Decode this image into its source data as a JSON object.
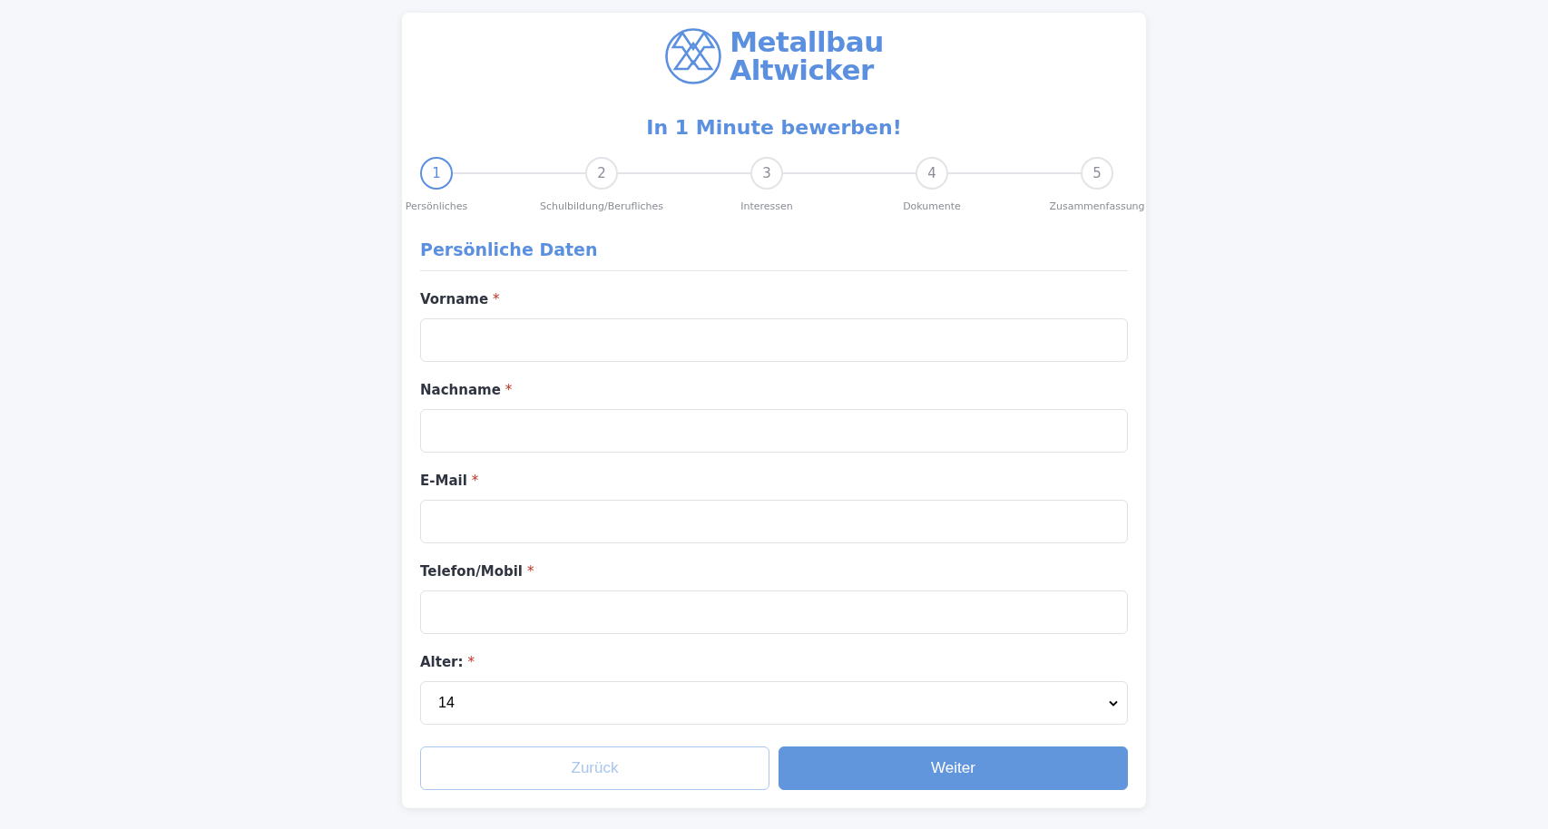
{
  "logo": {
    "line_1": "Metallbau",
    "line_2": "Altwicker"
  },
  "title": "In 1 Minute bewerben!",
  "steps": [
    {
      "number": "1",
      "label": "Persönliches",
      "selected": true
    },
    {
      "number": "2",
      "label": "Schulbildung/Berufliches",
      "selected": false
    },
    {
      "number": "3",
      "label": "Interessen",
      "selected": false
    },
    {
      "number": "4",
      "label": "Dokumente",
      "selected": false
    },
    {
      "number": "5",
      "label": "Zusammenfassung",
      "selected": false
    }
  ],
  "section_title": "Persönliche Daten",
  "fields": [
    {
      "kind": "text",
      "label": "Vorname",
      "required_mark": "*"
    },
    {
      "kind": "text",
      "label": "Nachname",
      "required_mark": "*"
    },
    {
      "kind": "text",
      "label": "E-Mail",
      "required_mark": "*"
    },
    {
      "kind": "text",
      "label": "Telefon/Mobil",
      "required_mark": "*"
    },
    {
      "kind": "select",
      "label": "Alter:",
      "required_mark": "*",
      "value": "14"
    }
  ],
  "buttons": [
    {
      "label": "Zurück",
      "kind": "secondary",
      "disabled": true
    },
    {
      "label": "Weiter",
      "kind": "primary",
      "disabled": false
    }
  ]
}
